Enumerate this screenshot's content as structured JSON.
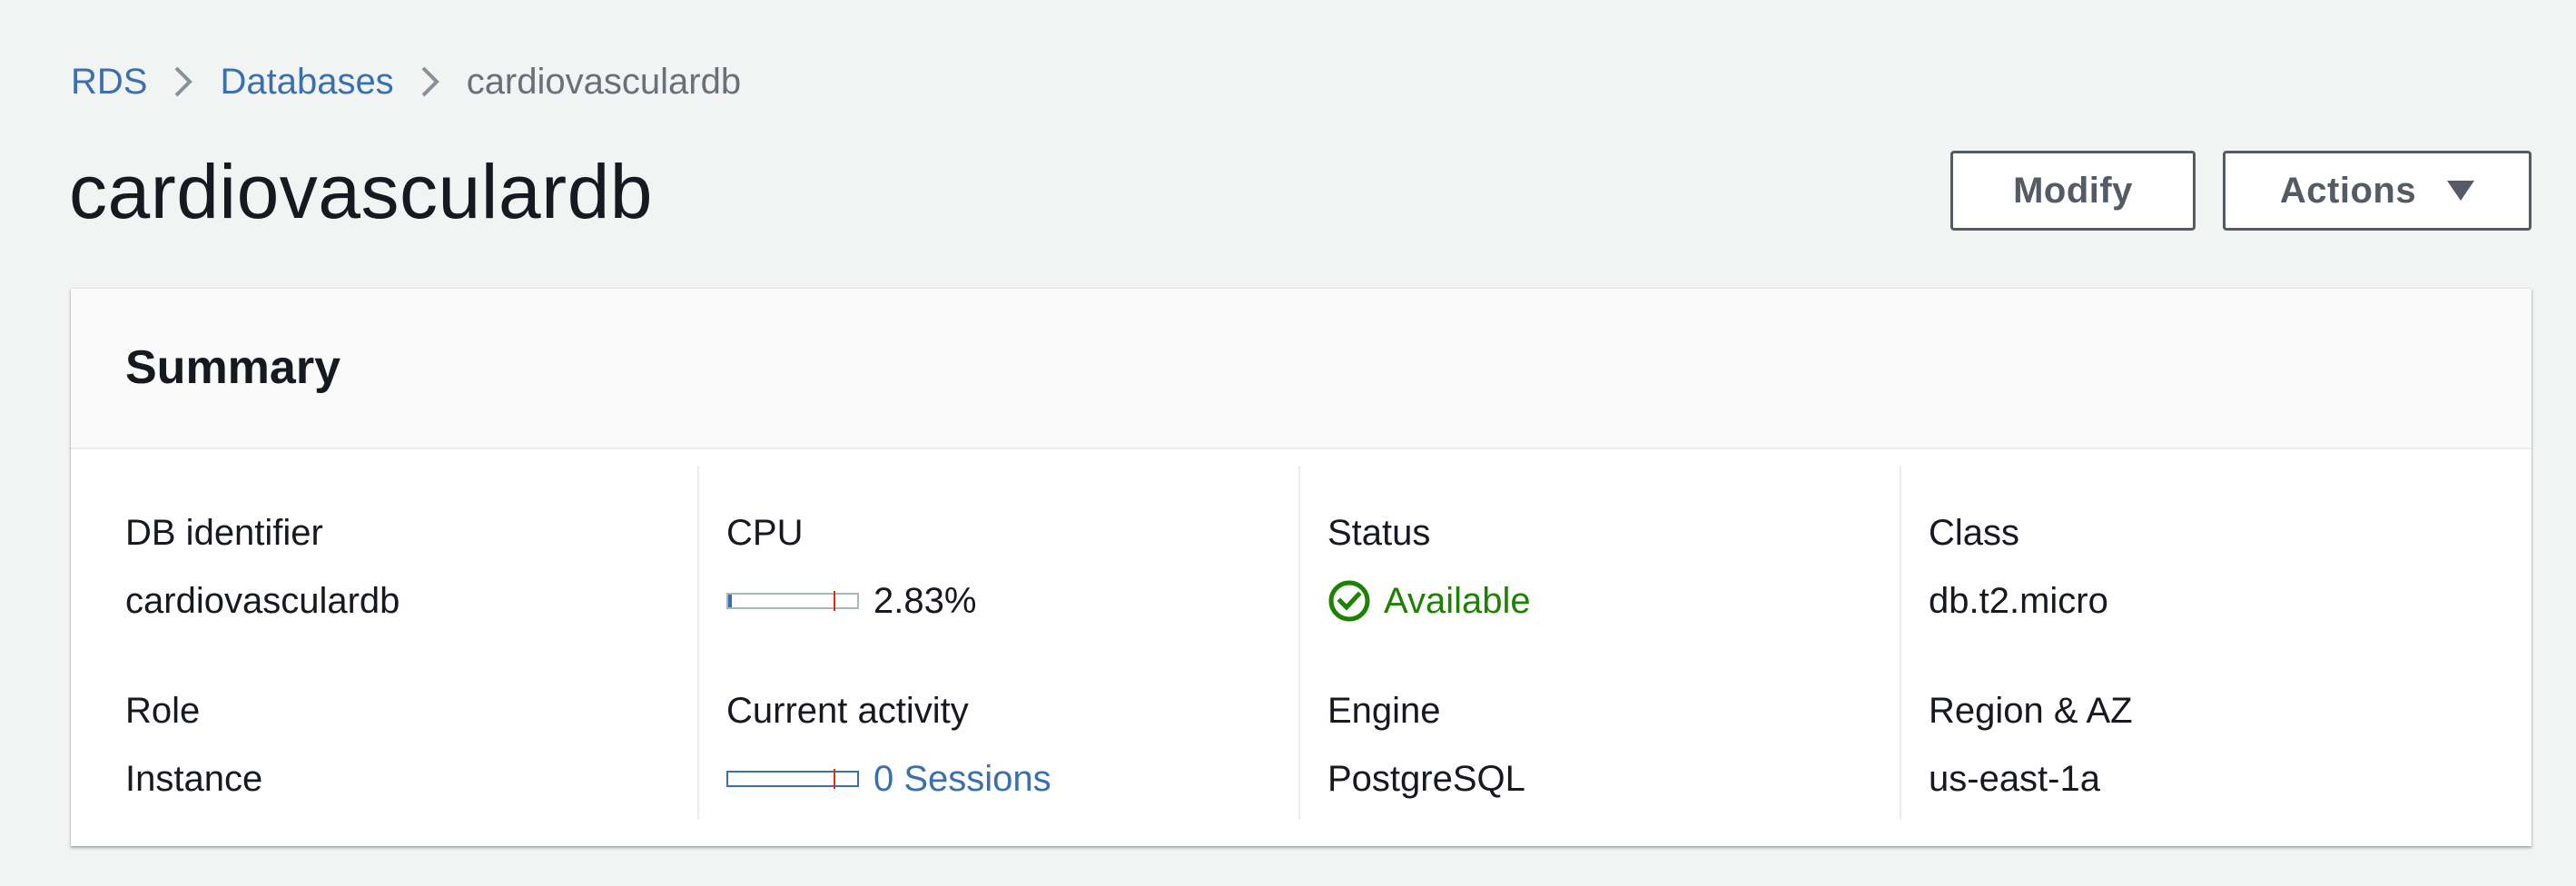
{
  "breadcrumb": {
    "items": [
      {
        "label": "RDS"
      },
      {
        "label": "Databases"
      },
      {
        "label": "cardiovasculardb"
      }
    ]
  },
  "page": {
    "title": "cardiovasculardb"
  },
  "toolbar": {
    "modify_label": "Modify",
    "actions_label": "Actions"
  },
  "summary": {
    "title": "Summary",
    "db_identifier": {
      "label": "DB identifier",
      "value": "cardiovasculardb"
    },
    "cpu": {
      "label": "CPU",
      "value": "2.83%",
      "fraction": 0.0283,
      "threshold_fraction": 0.82
    },
    "status": {
      "label": "Status",
      "value": "Available"
    },
    "class": {
      "label": "Class",
      "value": "db.t2.micro"
    },
    "role": {
      "label": "Role",
      "value": "Instance"
    },
    "current_activity": {
      "label": "Current activity",
      "value": "0 Sessions",
      "fraction": 0,
      "threshold_fraction": 0.82
    },
    "engine": {
      "label": "Engine",
      "value": "PostgreSQL"
    },
    "region_az": {
      "label": "Region & AZ",
      "value": "us-east-1a"
    }
  },
  "icons": {
    "breadcrumb_separator": "chevron-right-icon",
    "status": "check-circle-icon",
    "actions_dropdown": "caret-down-icon"
  },
  "colors": {
    "link": "#3a6fb0",
    "status_available": "#1d8102",
    "threshold": "#d13212",
    "background": "#f2f3f3"
  }
}
